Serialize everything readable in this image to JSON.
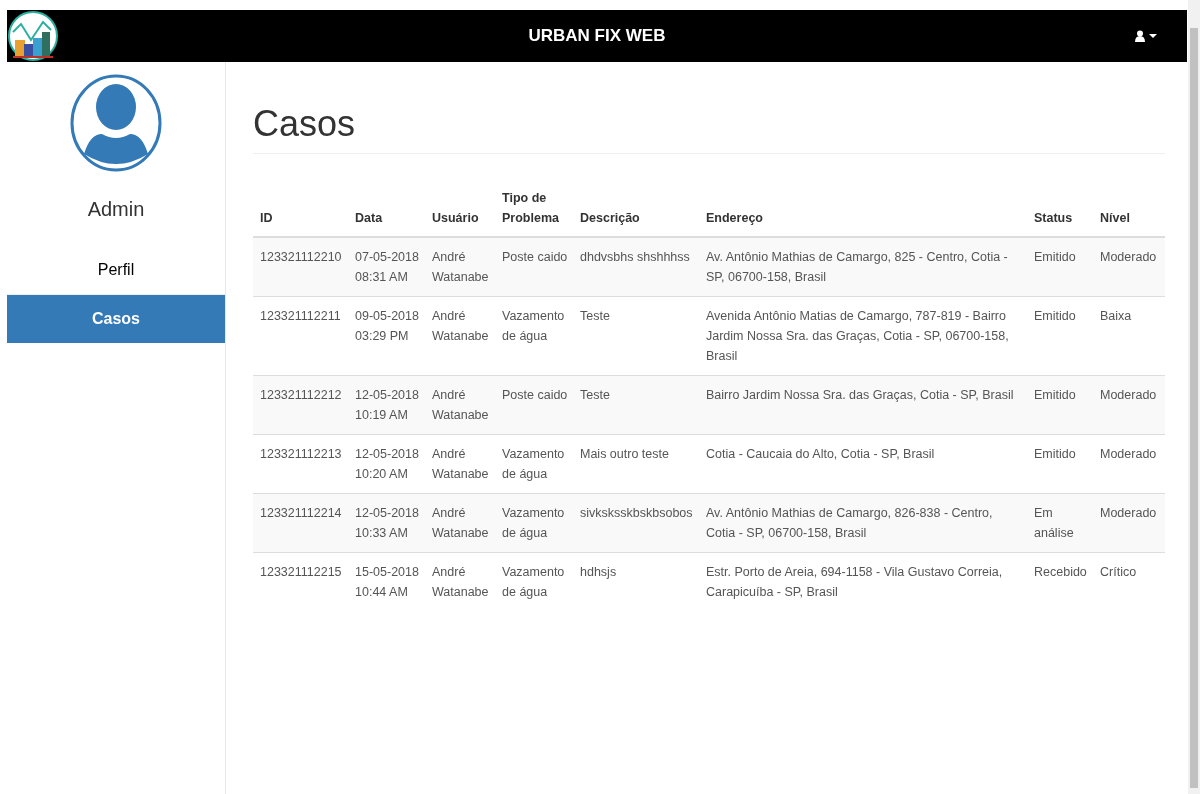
{
  "navbar": {
    "title": "URBAN FIX WEB"
  },
  "sidebar": {
    "user_name": "Admin",
    "items": [
      {
        "label": "Perfil",
        "selected": false
      },
      {
        "label": "Casos",
        "selected": true
      }
    ]
  },
  "page_title": "Casos",
  "table": {
    "columns": [
      "ID",
      "Data",
      "Usuário",
      "Tipo de Problema",
      "Descrição",
      "Endereço",
      "Status",
      "Nível"
    ],
    "rows": [
      [
        "123321112210",
        "07-05-2018 08:31 AM",
        "André Watanabe",
        "Poste caido",
        "dhdvsbhs shshhhss",
        "Av. Antônio Mathias de Camargo, 825 - Centro, Cotia - SP, 06700-158, Brasil",
        "Emitido",
        "Moderado"
      ],
      [
        "123321112211",
        "09-05-2018 03:29 PM",
        "André Watanabe",
        "Vazamento de água",
        "Teste",
        "Avenida Antônio Matias de Camargo, 787-819 - Bairro Jardim Nossa Sra. das Graças, Cotia - SP, 06700-158, Brasil",
        "Emitido",
        "Baixa"
      ],
      [
        "123321112212",
        "12-05-2018 10:19 AM",
        "André Watanabe",
        "Poste caido",
        "Teste",
        "Bairro Jardim Nossa Sra. das Graças, Cotia - SP, Brasil",
        "Emitido",
        "Moderado"
      ],
      [
        "123321112213",
        "12-05-2018 10:20 AM",
        "André Watanabe",
        "Vazamento de água",
        "Mais outro teste",
        "Cotia - Caucaia do Alto, Cotia - SP, Brasil",
        "Emitido",
        "Moderado"
      ],
      [
        "123321112214",
        "12-05-2018 10:33 AM",
        "André Watanabe",
        "Vazamento de água",
        "sivksksskbskbsobos",
        "Av. Antônio Mathias de Camargo, 826-838 - Centro, Cotia - SP, 06700-158, Brasil",
        "Em análise",
        "Moderado"
      ],
      [
        "123321112215",
        "15-05-2018 10:44 AM",
        "André Watanabe",
        "Vazamento de água",
        "hdhsjs",
        "Estr. Porto de Areia, 694-1158 - Vila Gustavo Correia, Carapicuíba - SP, Brasil",
        "Recebido",
        "Crítico"
      ]
    ]
  }
}
